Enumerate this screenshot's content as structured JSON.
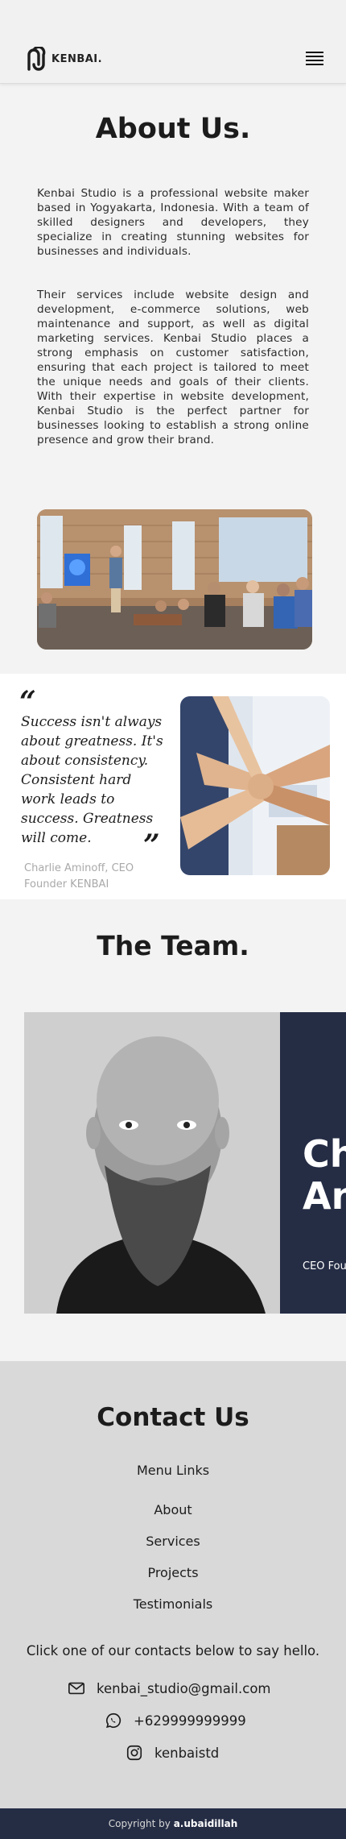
{
  "header": {
    "logo_text": "KENBAI."
  },
  "about": {
    "title": "About Us.",
    "paragraph1": "Kenbai Studio is a professional website maker based in Yogyakarta, Indonesia. With a team of skilled designers and developers, they specialize in creating stunning websites for businesses and individuals.",
    "paragraph2": "Their services include website design and development, e-commerce solutions, web maintenance and support, as well as digital marketing services. Kenbai Studio places a strong emphasis on customer satisfaction, ensuring that each project is tailored to meet the unique needs and goals of their clients. With their expertise in website development, Kenbai Studio is the perfect partner for businesses looking to establish a strong online presence and grow their brand."
  },
  "quote": {
    "open_mark": "“",
    "text": "Success isn't always about greatness. It's about consistency. Consistent hard work leads to success. Greatness will come.",
    "close_mark": "”",
    "author_name": "Charlie Aminoff, CEO",
    "author_company": "Founder KENBAI"
  },
  "team": {
    "title": "The Team.",
    "member_name_line1": "Ch",
    "member_name_line2": "An",
    "member_role": "CEO Fou"
  },
  "contact": {
    "title": "Contact Us",
    "menu_title": "Menu Links",
    "links": [
      "About",
      "Services",
      "Projects",
      "Testimonials"
    ],
    "prompt": "Click one of our contacts below to say hello.",
    "email": "kenbai_studio@gmail.com",
    "phone": "+629999999999",
    "instagram": "kenbaistd"
  },
  "footer": {
    "prefix": "Copyright by ",
    "author": "a.ubaidillah"
  },
  "colors": {
    "navy": "#252d45",
    "page_bg": "#f3f3f3",
    "contact_bg": "#d9d9d9"
  }
}
